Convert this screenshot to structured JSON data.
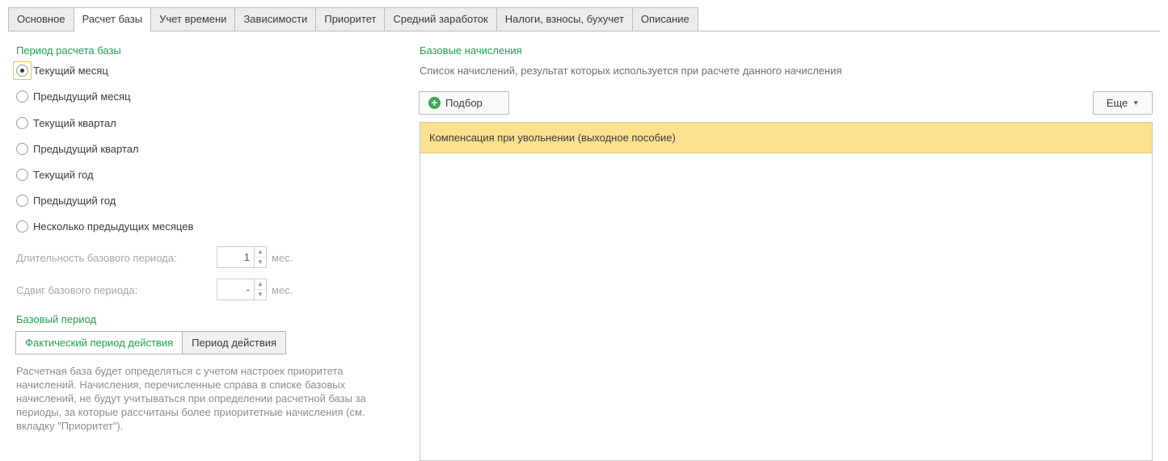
{
  "tabs": [
    {
      "label": "Основное",
      "active": false
    },
    {
      "label": "Расчет базы",
      "active": true
    },
    {
      "label": "Учет времени",
      "active": false
    },
    {
      "label": "Зависимости",
      "active": false
    },
    {
      "label": "Приоритет",
      "active": false
    },
    {
      "label": "Средний заработок",
      "active": false
    },
    {
      "label": "Налоги, взносы, бухучет",
      "active": false
    },
    {
      "label": "Описание",
      "active": false
    }
  ],
  "period": {
    "title": "Период расчета базы",
    "options": [
      "Текущий месяц",
      "Предыдущий месяц",
      "Текущий квартал",
      "Предыдущий квартал",
      "Текущий год",
      "Предыдущий год",
      "Несколько предыдущих месяцев"
    ],
    "selected_index": 0
  },
  "duration": {
    "label": "Длительность базового периода:",
    "value": "1",
    "unit": "мес."
  },
  "shift": {
    "label": "Сдвиг базового периода:",
    "value": "-",
    "unit": "мес."
  },
  "base_period": {
    "title": "Базовый период",
    "option_actual": "Фактический период действия",
    "option_period": "Период действия",
    "note": "Расчетная база будет определяться с учетом настроек приоритета начислений. Начисления, перечисленные справа в списке базовых начислений, не будут учитываться при определении расчетной базы за периоды, за которые рассчитаны более приоритетные начисления (см. вкладку \"Приоритет\")."
  },
  "base_accruals": {
    "title": "Базовые начисления",
    "description": "Список начислений, результат которых используется при расчете данного начисления",
    "select_button": "Подбор",
    "more_button": "Еще",
    "rows": [
      "Компенсация при увольнении (выходное пособие)"
    ]
  },
  "colors": {
    "accent_green": "#1f9f55",
    "selected_row": "#fbe190",
    "focus": "#f5c242"
  }
}
